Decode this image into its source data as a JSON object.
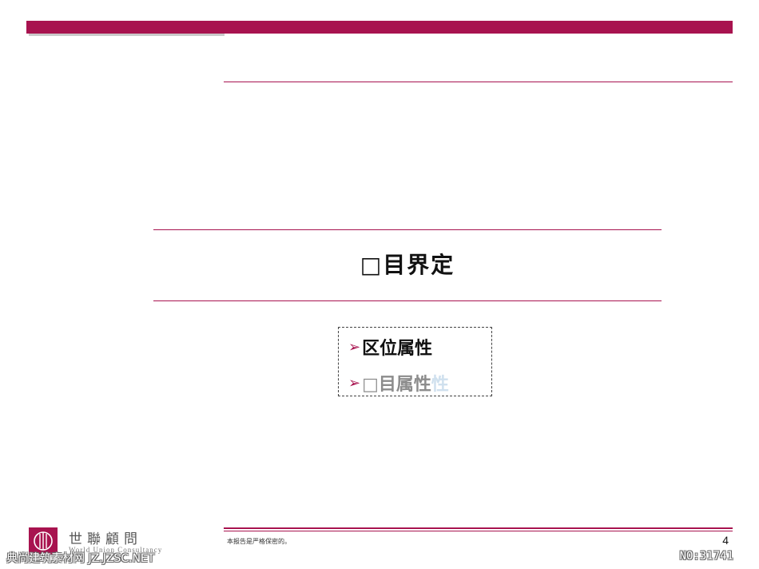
{
  "slide": {
    "section_title": "□目界定",
    "bullets": [
      {
        "text": "区位属性"
      },
      {
        "text": "□目属性",
        "ghost": "性"
      }
    ],
    "confidential_note": "本报告是严格保密的。",
    "page_number": "4"
  },
  "logo": {
    "name_cn": "世聯顧問",
    "name_en": "World Union Consultancy"
  },
  "watermark": {
    "left": "典尚建筑素材网 JZ.JZSC.NET",
    "right": "NO:31741"
  },
  "colors": {
    "accent": "#a8134f",
    "text": "#111111",
    "muted": "#8c8c8c"
  },
  "icons": {
    "bullet": "arrow-right-icon",
    "logo": "world-union-logo-icon"
  }
}
